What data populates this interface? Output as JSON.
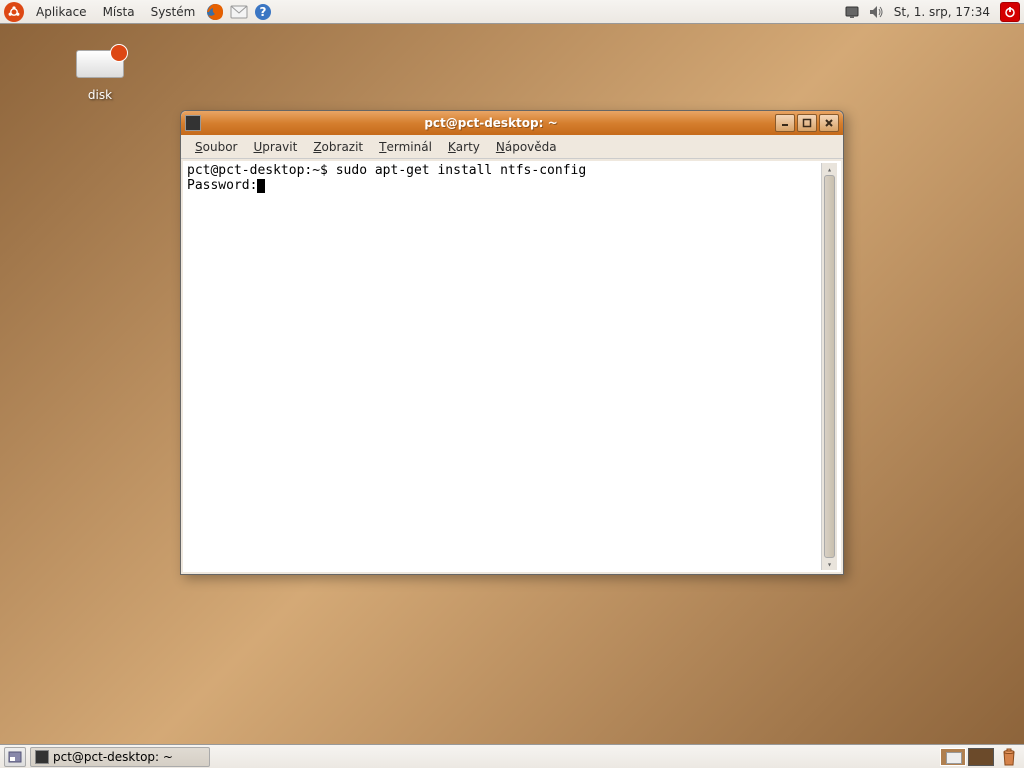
{
  "panel": {
    "menu": [
      "Aplikace",
      "Místa",
      "Systém"
    ],
    "clock": "St,  1. srp, 17:34"
  },
  "desktop": {
    "disk_label": "disk"
  },
  "terminal": {
    "title": "pct@pct-desktop: ~",
    "menus": [
      {
        "u": "S",
        "rest": "oubor"
      },
      {
        "u": "U",
        "rest": "pravit"
      },
      {
        "u": "Z",
        "rest": "obrazit"
      },
      {
        "u": "T",
        "rest": "erminál"
      },
      {
        "u": "K",
        "rest": "arty"
      },
      {
        "u": "N",
        "rest": "ápověda"
      }
    ],
    "line1_prompt": "pct@pct-desktop:~$ ",
    "line1_cmd": "sudo apt-get install ntfs-config",
    "line2": "Password:"
  },
  "taskbar": {
    "task_label": "pct@pct-desktop: ~"
  }
}
